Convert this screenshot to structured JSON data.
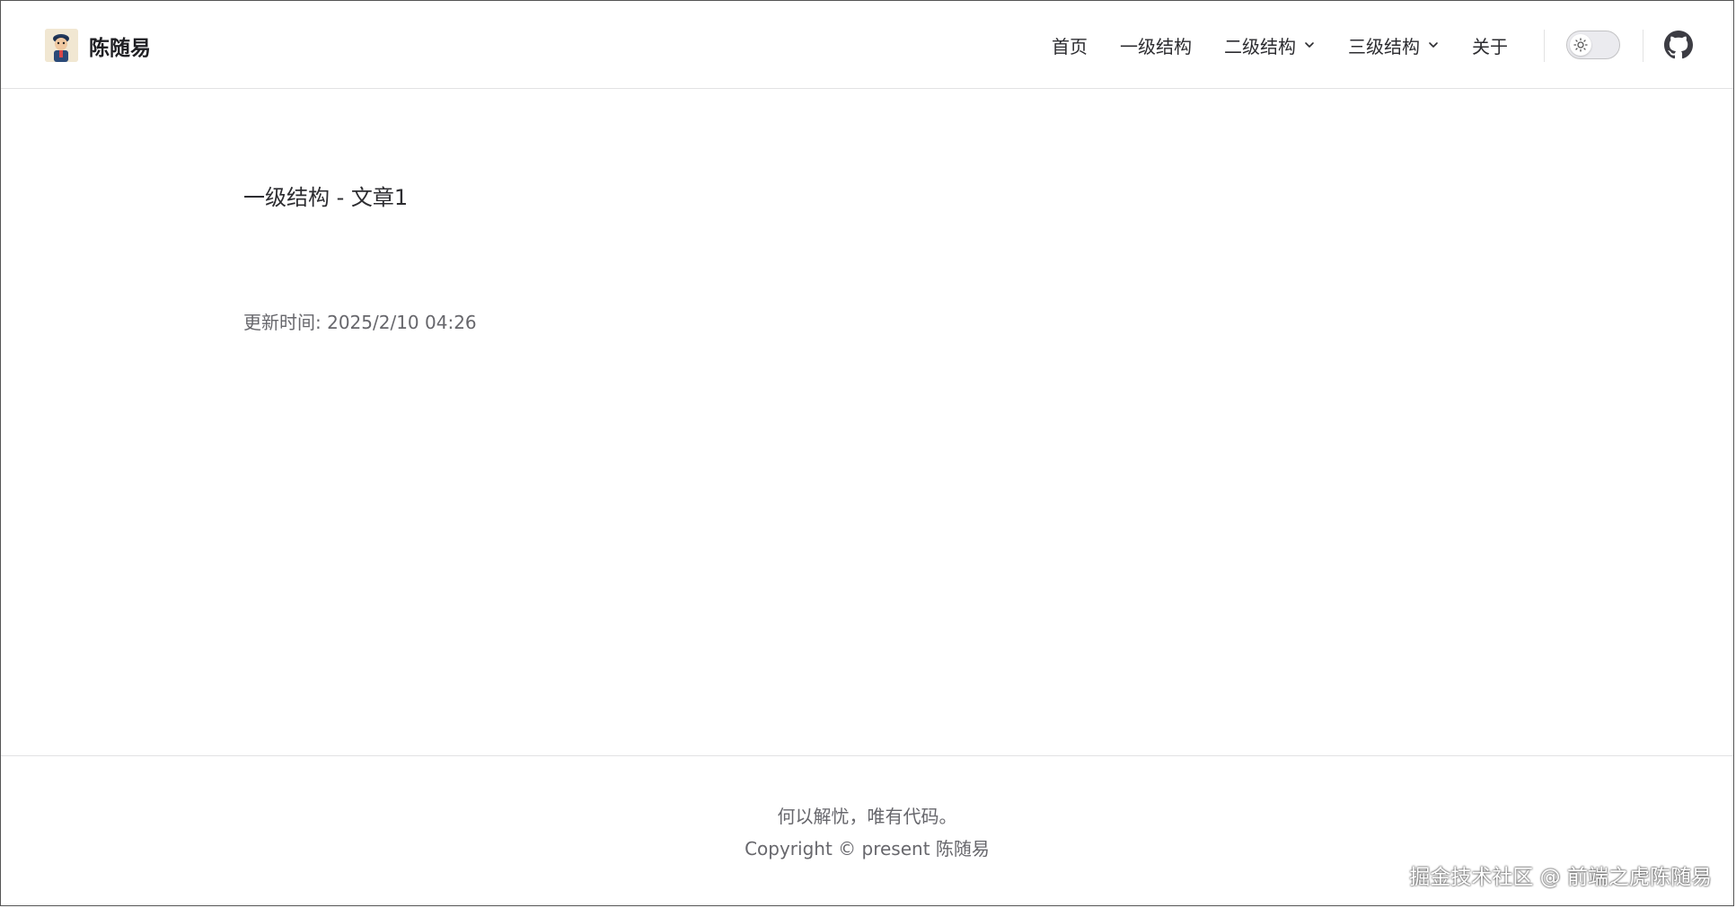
{
  "brand": {
    "title": "陈随易"
  },
  "nav": {
    "items": [
      {
        "label": "首页",
        "has_dropdown": false
      },
      {
        "label": "一级结构",
        "has_dropdown": false
      },
      {
        "label": "二级结构",
        "has_dropdown": true
      },
      {
        "label": "三级结构",
        "has_dropdown": true
      },
      {
        "label": "关于",
        "has_dropdown": false
      }
    ],
    "icons": {
      "theme_toggle": "sun-icon",
      "github": "github-icon",
      "dropdown": "chevron-down-icon"
    }
  },
  "main": {
    "title": "一级结构 - 文章1",
    "updated_label": "更新时间: ",
    "updated_value": "2025/2/10 04:26"
  },
  "footer": {
    "message": "何以解忧，唯有代码。",
    "copyright": "Copyright © present 陈随易"
  },
  "watermark": "掘金技术社区 @ 前端之虎陈随易"
}
